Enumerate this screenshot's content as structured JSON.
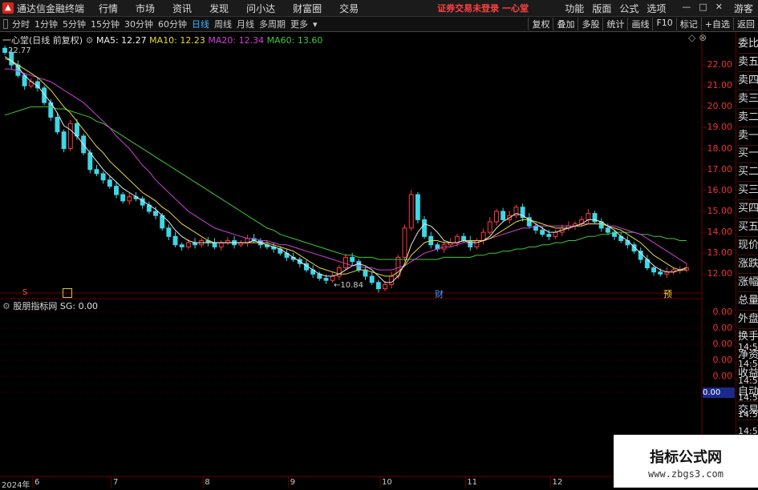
{
  "app_title": "通达信金融终端",
  "menu": [
    "行情",
    "市场",
    "资讯",
    "发现",
    "问小达",
    "财富圈",
    "交易"
  ],
  "warning": "证券交易未登录 一心堂",
  "menu_right": [
    "功能",
    "版面",
    "公式",
    "选项"
  ],
  "user": "游客",
  "periods": [
    "分时",
    "1分钟",
    "5分钟",
    "15分钟",
    "30分钟",
    "60分钟",
    "日线",
    "周线",
    "月线",
    "多周期",
    "更多"
  ],
  "toolbar_right": [
    "复权",
    "叠加",
    "多股",
    "统计",
    "画线",
    "F10",
    "标记",
    "+自选",
    "返回"
  ],
  "chart_header": {
    "stock": "一心堂(日线 前复权)",
    "ma5": "MA5: 12.27",
    "ma10": "MA10: 12.23",
    "ma20": "MA20: 12.34",
    "ma60": "MA60: 13.60"
  },
  "indicator_header": {
    "name": "股朋指标网",
    "value": "SG: 0.00"
  },
  "annotations": {
    "high": "22.77",
    "low": "←10.84",
    "marker_cai": "财",
    "marker_yu": "预",
    "marker_s": "S"
  },
  "colors": {
    "up": "#ff3b3b",
    "down": "#3fd6e6",
    "ma5": "#e8e8e8",
    "ma10": "#e6d83a",
    "ma20": "#d040d8",
    "ma60": "#3cc83c"
  },
  "sidebar": [
    "委比",
    "卖五",
    "卖四",
    "卖三",
    "卖二",
    "卖一",
    "买一",
    "买二",
    "买三",
    "买四",
    "买五",
    "现价",
    "涨跌",
    "涨幅",
    "总量",
    "外盘",
    "换手",
    "净资",
    "收益",
    "自动",
    "交易"
  ],
  "time_items": [
    "14:56",
    "14:56",
    "14:56",
    "14:56",
    "14:56",
    "14:56",
    "14:56",
    "14:56"
  ],
  "watermark": {
    "title": "指标公式网",
    "url": "www.zbgs3.com"
  },
  "chart_data": {
    "type": "candlestick",
    "ylim": [
      11.4,
      23.0
    ],
    "y_ticks": [
      12.0,
      13.0,
      14.0,
      15.0,
      16.0,
      17.0,
      18.0,
      19.0,
      20.0,
      21.0,
      22.0
    ],
    "x_ticks": [
      "2024年",
      "6",
      "7",
      "8",
      "9",
      "10",
      "11",
      "12"
    ],
    "indicator_ticks": [
      "0.00",
      "0.00",
      "0.00",
      "0.00",
      "0.00",
      "0.00"
    ],
    "indicator_current": "0.00",
    "close": [
      22.6,
      22.0,
      21.5,
      21.0,
      21.2,
      20.9,
      20.2,
      19.5,
      18.8,
      18.0,
      19.2,
      18.6,
      17.8,
      17.0,
      16.8,
      16.5,
      16.2,
      15.8,
      15.5,
      15.7,
      15.6,
      15.3,
      15.0,
      14.8,
      14.2,
      13.8,
      13.4,
      13.3,
      13.5,
      13.4,
      13.6,
      13.5,
      13.3,
      13.5,
      13.6,
      13.4,
      13.5,
      13.7,
      13.6,
      13.4,
      13.3,
      13.2,
      13.0,
      12.8,
      12.7,
      12.5,
      12.2,
      12.0,
      11.8,
      11.7,
      11.9,
      12.3,
      12.8,
      12.6,
      12.2,
      11.9,
      11.6,
      11.3,
      11.5,
      11.9,
      12.8,
      14.2,
      15.8,
      14.6,
      13.8,
      13.4,
      13.2,
      13.4,
      13.5,
      13.8,
      13.6,
      13.3,
      13.6,
      14.0,
      14.5,
      15.0,
      14.6,
      14.8,
      15.2,
      14.7,
      14.3,
      14.1,
      13.9,
      13.8,
      14.0,
      14.2,
      14.3,
      14.4,
      14.6,
      14.9,
      14.5,
      14.2,
      14.0,
      13.8,
      13.6,
      13.4,
      13.1,
      12.7,
      12.3,
      12.1,
      12.0,
      12.1,
      12.2,
      12.2,
      12.3
    ],
    "ma5": [
      22.4,
      22.2,
      21.9,
      21.5,
      21.2,
      21.0,
      20.6,
      20.2,
      19.7,
      19.1,
      18.9,
      18.6,
      18.2,
      17.8,
      17.4,
      17.0,
      16.7,
      16.4,
      16.1,
      15.9,
      15.7,
      15.5,
      15.3,
      15.1,
      14.8,
      14.5,
      14.1,
      13.8,
      13.6,
      13.5,
      13.5,
      13.5,
      13.5,
      13.5,
      13.5,
      13.5,
      13.5,
      13.5,
      13.6,
      13.5,
      13.4,
      13.3,
      13.2,
      13.0,
      12.8,
      12.6,
      12.4,
      12.2,
      12.0,
      11.9,
      11.9,
      12.0,
      12.2,
      12.4,
      12.5,
      12.4,
      12.2,
      11.9,
      11.6,
      11.6,
      11.9,
      12.5,
      13.4,
      14.0,
      14.4,
      14.3,
      14.0,
      13.6,
      13.5,
      13.5,
      13.6,
      13.5,
      13.5,
      13.6,
      13.8,
      14.2,
      14.5,
      14.7,
      14.9,
      14.8,
      14.6,
      14.4,
      14.2,
      14.0,
      14.0,
      14.1,
      14.2,
      14.3,
      14.4,
      14.6,
      14.6,
      14.5,
      14.3,
      14.1,
      13.8,
      13.6,
      13.3,
      13.0,
      12.7,
      12.4,
      12.2,
      12.1,
      12.1,
      12.2,
      12.3
    ],
    "ma10": [
      22.3,
      22.2,
      22.0,
      21.8,
      21.6,
      21.4,
      21.1,
      20.8,
      20.4,
      20.0,
      19.7,
      19.3,
      18.9,
      18.5,
      18.1,
      17.8,
      17.4,
      17.1,
      16.8,
      16.5,
      16.2,
      15.9,
      15.7,
      15.5,
      15.2,
      15.0,
      14.7,
      14.4,
      14.2,
      14.0,
      13.8,
      13.6,
      13.5,
      13.5,
      13.5,
      13.5,
      13.5,
      13.5,
      13.5,
      13.5,
      13.5,
      13.4,
      13.3,
      13.2,
      13.1,
      12.9,
      12.7,
      12.5,
      12.3,
      12.2,
      12.1,
      12.0,
      12.0,
      12.1,
      12.2,
      12.2,
      12.1,
      12.0,
      11.9,
      11.9,
      12.1,
      12.4,
      12.9,
      13.2,
      13.5,
      13.6,
      13.6,
      13.5,
      13.5,
      13.5,
      13.6,
      13.6,
      13.6,
      13.6,
      13.7,
      13.9,
      14.1,
      14.3,
      14.5,
      14.6,
      14.6,
      14.5,
      14.4,
      14.3,
      14.2,
      14.2,
      14.2,
      14.3,
      14.3,
      14.4,
      14.4,
      14.4,
      14.3,
      14.2,
      14.1,
      13.9,
      13.7,
      13.5,
      13.2,
      12.9,
      12.7,
      12.5,
      12.3,
      12.2,
      12.2
    ],
    "ma20": [
      21.8,
      21.8,
      21.7,
      21.6,
      21.5,
      21.4,
      21.3,
      21.2,
      21.0,
      20.8,
      20.6,
      20.4,
      20.2,
      19.9,
      19.6,
      19.3,
      19.0,
      18.6,
      18.3,
      18.0,
      17.6,
      17.2,
      16.9,
      16.5,
      16.2,
      15.9,
      15.6,
      15.3,
      15.0,
      14.8,
      14.6,
      14.4,
      14.2,
      14.1,
      14.0,
      13.9,
      13.8,
      13.7,
      13.7,
      13.6,
      13.6,
      13.5,
      13.4,
      13.4,
      13.3,
      13.2,
      13.1,
      13.0,
      12.9,
      12.8,
      12.7,
      12.6,
      12.5,
      12.4,
      12.4,
      12.3,
      12.3,
      12.2,
      12.2,
      12.2,
      12.3,
      12.4,
      12.6,
      12.8,
      13.0,
      13.1,
      13.2,
      13.3,
      13.3,
      13.4,
      13.5,
      13.5,
      13.6,
      13.6,
      13.7,
      13.8,
      13.9,
      14.0,
      14.1,
      14.2,
      14.2,
      14.3,
      14.3,
      14.3,
      14.3,
      14.3,
      14.3,
      14.3,
      14.4,
      14.4,
      14.4,
      14.4,
      14.3,
      14.3,
      14.2,
      14.1,
      14.0,
      13.9,
      13.7,
      13.5,
      13.3,
      13.1,
      12.9,
      12.7,
      12.5
    ],
    "ma60": [
      19.6,
      19.7,
      19.8,
      19.9,
      20.0,
      20.0,
      20.0,
      20.0,
      19.9,
      19.9,
      19.8,
      19.7,
      19.6,
      19.5,
      19.3,
      19.2,
      19.0,
      18.8,
      18.6,
      18.4,
      18.2,
      18.0,
      17.8,
      17.6,
      17.4,
      17.2,
      17.0,
      16.8,
      16.6,
      16.4,
      16.2,
      16.0,
      15.8,
      15.6,
      15.4,
      15.2,
      15.0,
      14.8,
      14.6,
      14.4,
      14.2,
      14.1,
      13.9,
      13.8,
      13.7,
      13.6,
      13.5,
      13.4,
      13.3,
      13.2,
      13.1,
      13.0,
      12.9,
      12.9,
      12.8,
      12.8,
      12.8,
      12.7,
      12.7,
      12.7,
      12.7,
      12.7,
      12.7,
      12.7,
      12.7,
      12.7,
      12.7,
      12.8,
      12.8,
      12.8,
      12.8,
      12.8,
      12.9,
      12.9,
      13.0,
      13.0,
      13.1,
      13.1,
      13.2,
      13.2,
      13.3,
      13.3,
      13.4,
      13.4,
      13.5,
      13.5,
      13.6,
      13.6,
      13.7,
      13.8,
      13.8,
      13.9,
      13.9,
      14.0,
      14.0,
      14.0,
      14.0,
      13.9,
      13.9,
      13.8,
      13.8,
      13.7,
      13.7,
      13.6,
      13.6
    ]
  }
}
